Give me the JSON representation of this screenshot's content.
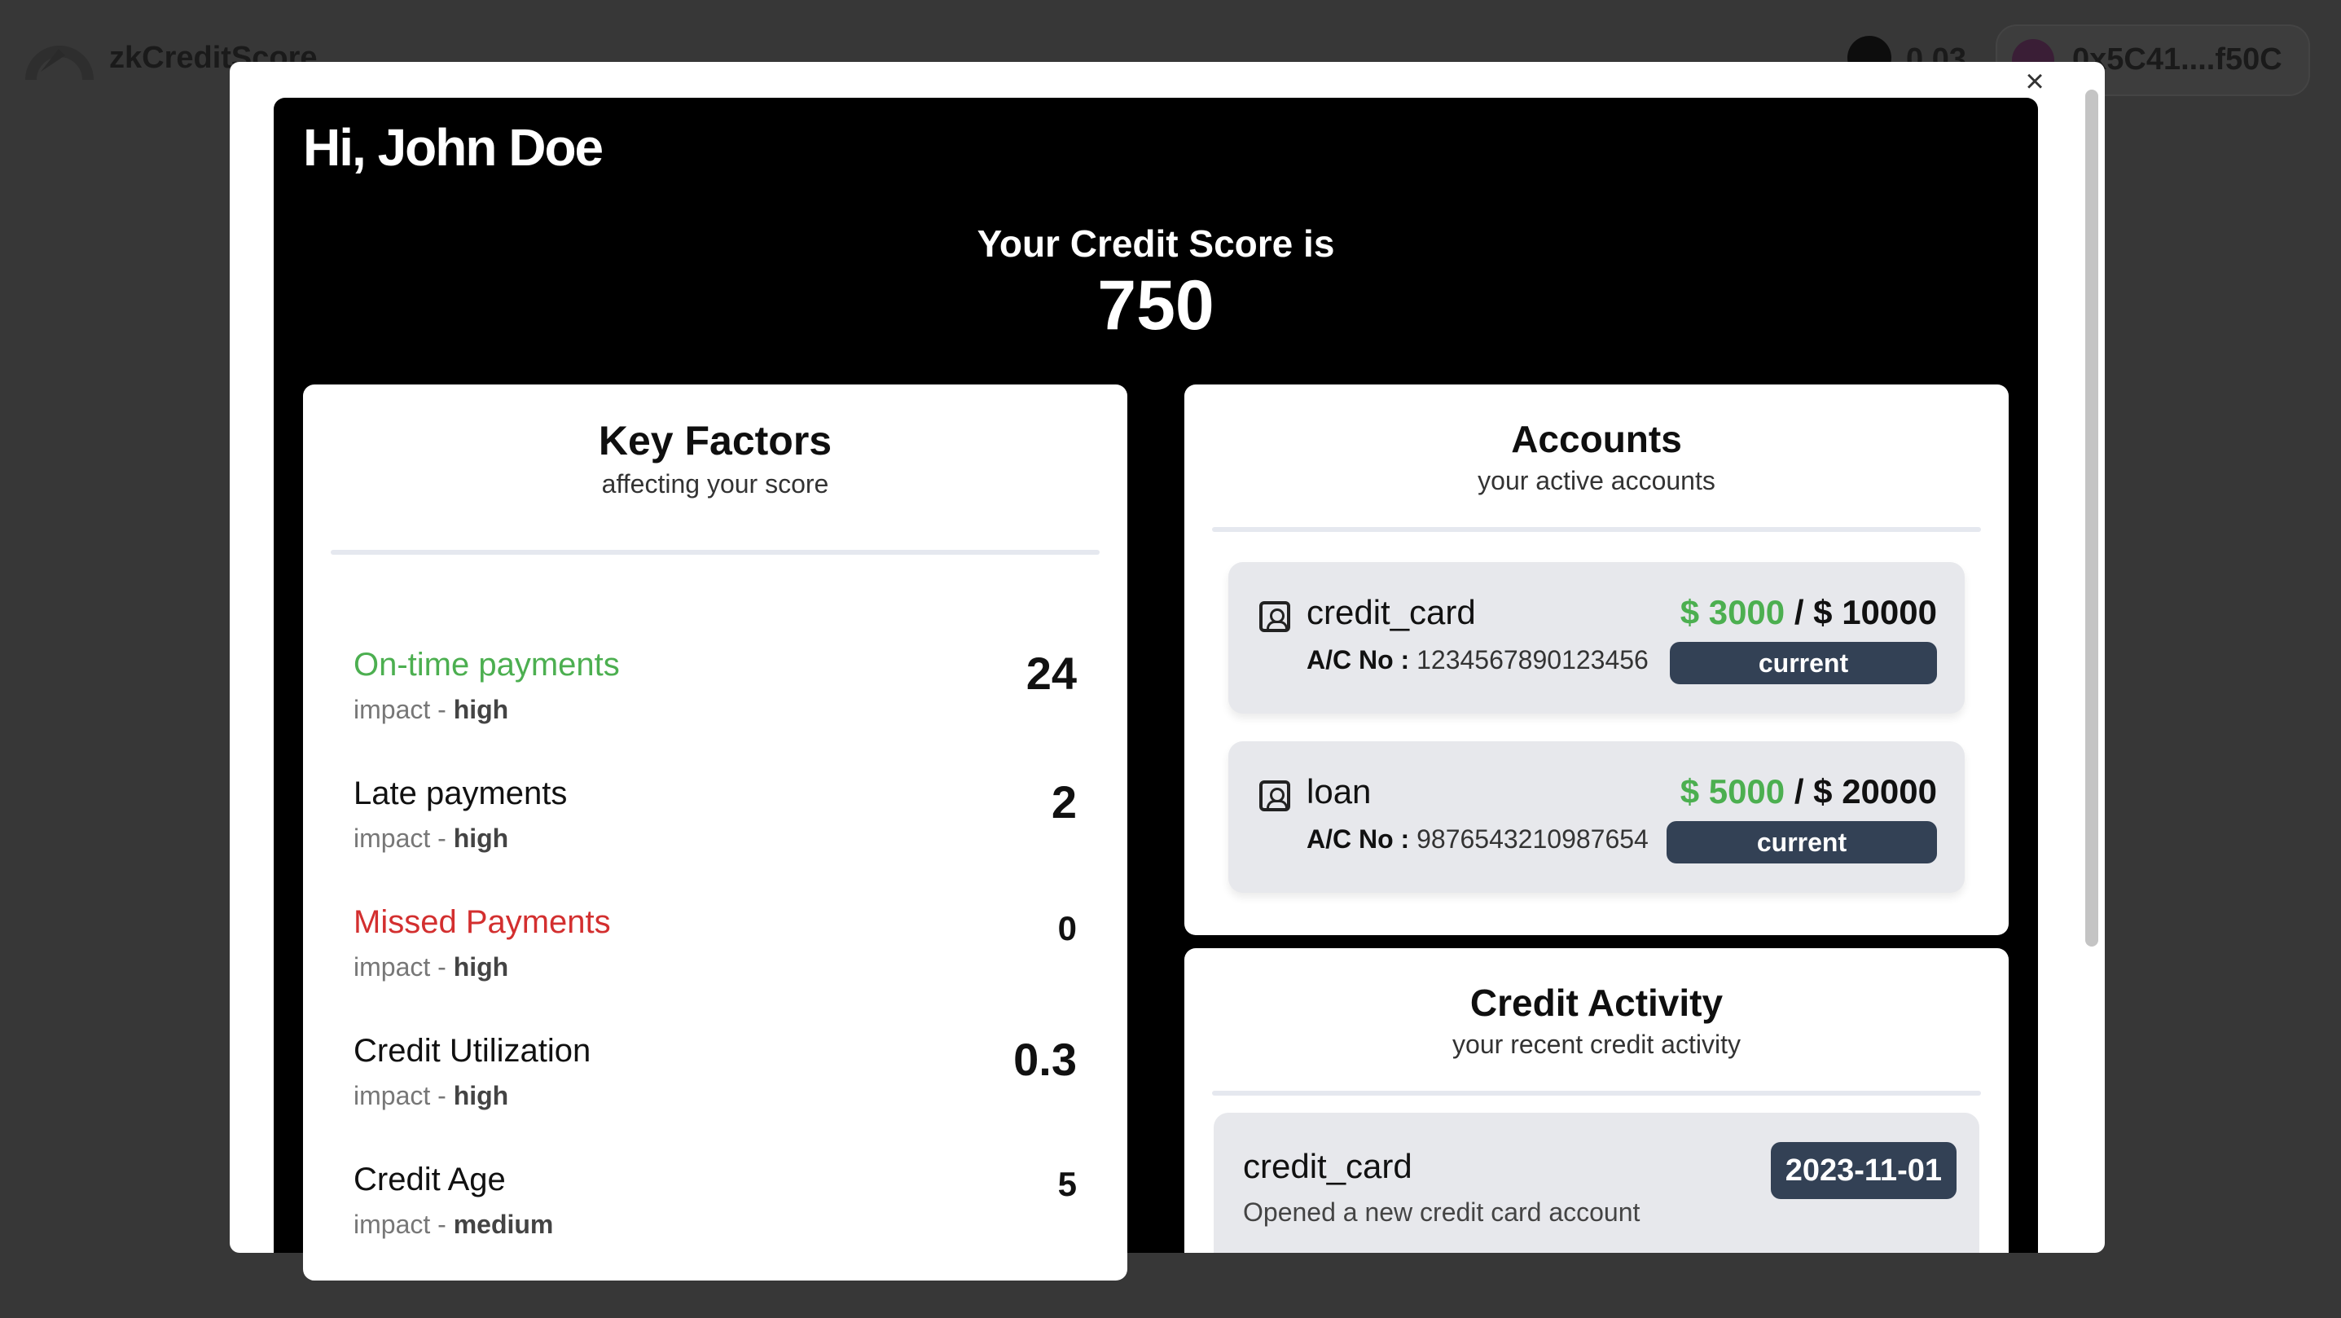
{
  "app": {
    "name": "zkCreditScore",
    "balance": "0.03",
    "wallet_address": "0x5C41....f50C"
  },
  "modal": {
    "close_label": "×",
    "greeting": "Hi, John Doe",
    "score_label": "Your Credit Score is",
    "score_value": "750"
  },
  "key_factors": {
    "title": "Key Factors",
    "subtitle": "affecting your score",
    "items": [
      {
        "name": "On-time payments",
        "impact_prefix": "impact - ",
        "impact": "high",
        "value": "24"
      },
      {
        "name": "Late payments",
        "impact_prefix": "impact - ",
        "impact": "high",
        "value": "2"
      },
      {
        "name": "Missed Payments",
        "impact_prefix": "impact - ",
        "impact": "high",
        "value": "0"
      },
      {
        "name": "Credit Utilization",
        "impact_prefix": "impact - ",
        "impact": "high",
        "value": "0.3"
      },
      {
        "name": "Credit Age",
        "impact_prefix": "impact - ",
        "impact": "medium",
        "value": "5"
      }
    ]
  },
  "accounts": {
    "title": "Accounts",
    "subtitle": "your active accounts",
    "ac_label": "A/C No :",
    "items": [
      {
        "type": "credit_card",
        "ac_no": "1234567890123456",
        "balance": "$ 3000",
        "separator": " / ",
        "limit": "$ 10000",
        "status": "current"
      },
      {
        "type": "loan",
        "ac_no": "9876543210987654",
        "balance": "$ 5000",
        "separator": " / ",
        "limit": "$ 20000",
        "status": "current"
      }
    ]
  },
  "credit_activity": {
    "title": "Credit Activity",
    "subtitle": "your recent credit activity",
    "items": [
      {
        "type": "credit_card",
        "description": "Opened a new credit card account",
        "date": "2023-11-01"
      }
    ]
  },
  "colors": {
    "positive": "#4caf50",
    "negative": "#d32f2f",
    "badge": "#334155",
    "panel": "#000000"
  }
}
